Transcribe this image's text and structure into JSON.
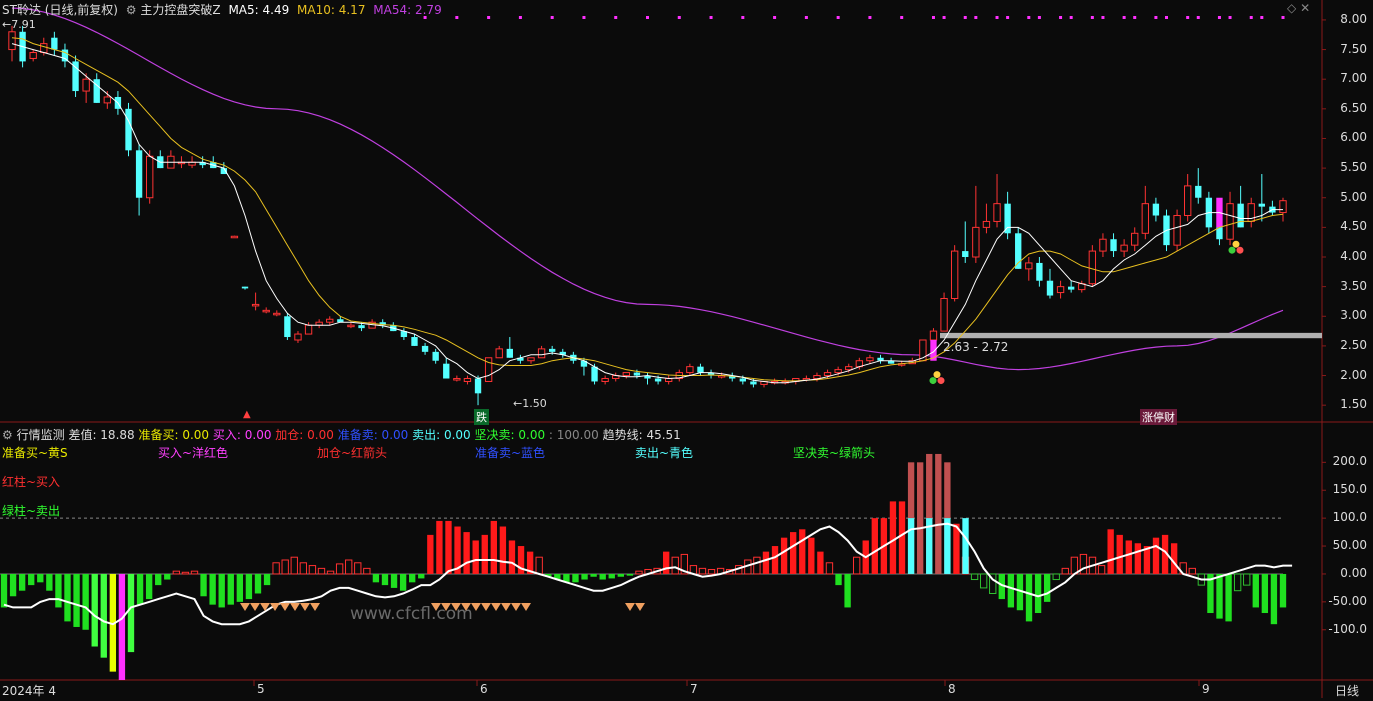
{
  "main_header": {
    "title": "ST聆达 (日线,前复权)",
    "indicator_name": "主力控盘突破Z",
    "ma5": "MA5: 4.49",
    "ma10": "MA10: 4.17",
    "ma54": "MA54: 2.79"
  },
  "sub_header": {
    "name": "行情监测",
    "diff": "差值: 18.88",
    "prep_buy": "准备买: 0.00",
    "buy": "买入: 0.00",
    "add": "加仓: 0.00",
    "prep_sell": "准备卖: 0.00",
    "sell": "卖出: 0.00",
    "firm_sell": "坚决卖: 0.00",
    "scale": ": 100.00",
    "trend": "趋势线: 45.51"
  },
  "legend": {
    "prep_buy": "准备买~黄S",
    "buy": "买入~洋红色",
    "add": "加仓~红箭头",
    "prep_sell": "准备卖~蓝色",
    "sell": "卖出~青色",
    "firm_sell": "坚决卖~绿箭头",
    "red_bar": "红柱~买入",
    "green_bar": "绿柱~卖出"
  },
  "annotations": {
    "high": "7.91",
    "low": "1.50",
    "range": "2.63 - 2.72",
    "fall": "跌",
    "limit_up": "涨停财"
  },
  "price_axis": [
    "8.00",
    "7.50",
    "7.00",
    "6.50",
    "6.00",
    "5.50",
    "5.00",
    "4.50",
    "4.00",
    "3.50",
    "3.00",
    "2.50",
    "2.00",
    "1.50"
  ],
  "osc_axis": [
    "200.0",
    "150.0",
    "100.0",
    "50.00",
    "0.00",
    "-50.00",
    "-100.0"
  ],
  "time_axis": [
    "2024年 4",
    "5",
    "6",
    "7",
    "8",
    "9"
  ],
  "period": "日线",
  "watermark": "www.cfcfl.com",
  "colors": {
    "up": "#ff3333",
    "down": "#54ffff",
    "ma5": "#ffffff",
    "ma10": "#e8c020",
    "ma54": "#c040e0"
  },
  "chart_data": {
    "type": "candlestick",
    "ohlc": [
      [
        7.5,
        7.9,
        7.3,
        7.8
      ],
      [
        7.8,
        7.9,
        7.2,
        7.3
      ],
      [
        7.35,
        7.5,
        7.3,
        7.45
      ],
      [
        7.45,
        7.7,
        7.4,
        7.6
      ],
      [
        7.7,
        7.8,
        7.4,
        7.5
      ],
      [
        7.5,
        7.6,
        7.2,
        7.3
      ],
      [
        7.3,
        7.4,
        6.7,
        6.8
      ],
      [
        6.8,
        7.1,
        6.6,
        7.0
      ],
      [
        7.0,
        7.1,
        6.6,
        6.6
      ],
      [
        6.6,
        6.8,
        6.5,
        6.7
      ],
      [
        6.7,
        6.8,
        6.4,
        6.5
      ],
      [
        6.5,
        6.6,
        5.7,
        5.8
      ],
      [
        5.8,
        5.9,
        4.7,
        5.0
      ],
      [
        5.0,
        5.8,
        4.9,
        5.7
      ],
      [
        5.7,
        5.8,
        5.5,
        5.5
      ],
      [
        5.5,
        5.8,
        5.5,
        5.7
      ],
      [
        5.6,
        5.7,
        5.5,
        5.6
      ],
      [
        5.55,
        5.7,
        5.5,
        5.6
      ],
      [
        5.6,
        5.7,
        5.5,
        5.55
      ],
      [
        5.6,
        5.7,
        5.5,
        5.5
      ],
      [
        5.5,
        5.6,
        5.4,
        5.4
      ],
      [
        4.35,
        4.36,
        4.34,
        4.35
      ],
      [
        3.5,
        3.5,
        3.45,
        3.47
      ],
      [
        3.2,
        3.4,
        3.1,
        3.2
      ],
      [
        3.1,
        3.15,
        3.05,
        3.1
      ],
      [
        3.05,
        3.1,
        3.0,
        3.05
      ],
      [
        3.0,
        3.05,
        2.6,
        2.65
      ],
      [
        2.6,
        2.75,
        2.55,
        2.7
      ],
      [
        2.7,
        2.9,
        2.7,
        2.85
      ],
      [
        2.85,
        2.95,
        2.8,
        2.9
      ],
      [
        2.9,
        3.0,
        2.85,
        2.95
      ],
      [
        2.95,
        3.0,
        2.9,
        2.9
      ],
      [
        2.85,
        2.9,
        2.8,
        2.85
      ],
      [
        2.85,
        2.9,
        2.75,
        2.8
      ],
      [
        2.8,
        2.95,
        2.8,
        2.9
      ],
      [
        2.9,
        2.95,
        2.8,
        2.85
      ],
      [
        2.85,
        2.9,
        2.75,
        2.75
      ],
      [
        2.75,
        2.8,
        2.6,
        2.65
      ],
      [
        2.65,
        2.7,
        2.5,
        2.5
      ],
      [
        2.5,
        2.55,
        2.35,
        2.4
      ],
      [
        2.4,
        2.45,
        2.2,
        2.25
      ],
      [
        2.2,
        2.3,
        1.95,
        1.95
      ],
      [
        1.95,
        2.0,
        1.9,
        1.95
      ],
      [
        1.9,
        2.0,
        1.85,
        1.95
      ],
      [
        1.95,
        2.0,
        1.5,
        1.7
      ],
      [
        1.9,
        2.3,
        1.9,
        2.3
      ],
      [
        2.3,
        2.5,
        2.3,
        2.45
      ],
      [
        2.45,
        2.65,
        2.3,
        2.3
      ],
      [
        2.3,
        2.35,
        2.2,
        2.25
      ],
      [
        2.25,
        2.3,
        2.2,
        2.3
      ],
      [
        2.3,
        2.5,
        2.3,
        2.45
      ],
      [
        2.45,
        2.5,
        2.35,
        2.4
      ],
      [
        2.4,
        2.45,
        2.3,
        2.35
      ],
      [
        2.35,
        2.4,
        2.2,
        2.25
      ],
      [
        2.25,
        2.3,
        2.0,
        2.15
      ],
      [
        2.15,
        2.2,
        1.85,
        1.9
      ],
      [
        1.9,
        2.0,
        1.85,
        1.95
      ],
      [
        1.95,
        2.05,
        1.9,
        2.0
      ],
      [
        2.0,
        2.05,
        1.95,
        2.05
      ],
      [
        2.05,
        2.1,
        1.95,
        2.0
      ],
      [
        2.0,
        2.05,
        1.85,
        1.95
      ],
      [
        1.95,
        2.0,
        1.85,
        1.9
      ],
      [
        1.9,
        2.0,
        1.85,
        1.95
      ],
      [
        1.95,
        2.1,
        1.9,
        2.05
      ],
      [
        2.05,
        2.2,
        2.0,
        2.15
      ],
      [
        2.15,
        2.2,
        2.0,
        2.05
      ],
      [
        2.05,
        2.1,
        1.95,
        2.0
      ],
      [
        2.0,
        2.05,
        1.95,
        2.0
      ],
      [
        2.0,
        2.05,
        1.9,
        1.95
      ],
      [
        1.95,
        2.0,
        1.85,
        1.9
      ],
      [
        1.9,
        1.95,
        1.8,
        1.85
      ],
      [
        1.85,
        1.9,
        1.8,
        1.9
      ],
      [
        1.9,
        1.95,
        1.85,
        1.9
      ],
      [
        1.9,
        1.95,
        1.85,
        1.9
      ],
      [
        1.9,
        1.95,
        1.85,
        1.95
      ],
      [
        1.95,
        2.0,
        1.9,
        1.95
      ],
      [
        1.95,
        2.05,
        1.9,
        2.0
      ],
      [
        2.0,
        2.1,
        1.95,
        2.05
      ],
      [
        2.05,
        2.15,
        2.0,
        2.1
      ],
      [
        2.1,
        2.2,
        2.05,
        2.15
      ],
      [
        2.15,
        2.3,
        2.1,
        2.25
      ],
      [
        2.25,
        2.35,
        2.2,
        2.3
      ],
      [
        2.3,
        2.35,
        2.2,
        2.25
      ],
      [
        2.25,
        2.3,
        2.2,
        2.2
      ],
      [
        2.2,
        2.25,
        2.15,
        2.2
      ],
      [
        2.2,
        2.3,
        2.2,
        2.25
      ],
      [
        2.25,
        2.6,
        2.25,
        2.6
      ],
      [
        2.6,
        2.8,
        2.6,
        2.75
      ],
      [
        2.75,
        3.4,
        2.75,
        3.3
      ],
      [
        3.3,
        4.2,
        3.25,
        4.1
      ],
      [
        4.1,
        4.6,
        3.9,
        4.0
      ],
      [
        4.0,
        5.2,
        3.9,
        4.5
      ],
      [
        4.5,
        4.9,
        4.4,
        4.6
      ],
      [
        4.6,
        5.4,
        4.5,
        4.9
      ],
      [
        4.9,
        5.1,
        4.3,
        4.4
      ],
      [
        4.4,
        4.5,
        3.8,
        3.8
      ],
      [
        3.8,
        4.0,
        3.6,
        3.9
      ],
      [
        3.9,
        4.0,
        3.5,
        3.6
      ],
      [
        3.6,
        3.8,
        3.3,
        3.35
      ],
      [
        3.4,
        3.6,
        3.3,
        3.5
      ],
      [
        3.5,
        3.6,
        3.4,
        3.45
      ],
      [
        3.45,
        3.6,
        3.4,
        3.55
      ],
      [
        3.55,
        4.2,
        3.5,
        4.1
      ],
      [
        4.1,
        4.4,
        4.0,
        4.3
      ],
      [
        4.3,
        4.4,
        4.0,
        4.1
      ],
      [
        4.1,
        4.3,
        4.0,
        4.2
      ],
      [
        4.2,
        4.5,
        4.1,
        4.4
      ],
      [
        4.4,
        5.2,
        4.3,
        4.9
      ],
      [
        4.9,
        5.0,
        4.6,
        4.7
      ],
      [
        4.7,
        4.8,
        4.1,
        4.2
      ],
      [
        4.2,
        4.8,
        4.1,
        4.7
      ],
      [
        4.7,
        5.4,
        4.6,
        5.2
      ],
      [
        5.2,
        5.5,
        4.9,
        5.0
      ],
      [
        5.0,
        5.1,
        4.4,
        4.5
      ],
      [
        4.5,
        4.6,
        4.2,
        4.3
      ],
      [
        4.3,
        5.1,
        4.2,
        4.9
      ],
      [
        4.9,
        5.2,
        4.5,
        4.5
      ],
      [
        4.6,
        5.0,
        4.5,
        4.9
      ],
      [
        4.9,
        5.4,
        4.6,
        4.85
      ],
      [
        4.85,
        4.95,
        4.7,
        4.75
      ],
      [
        4.75,
        5.0,
        4.6,
        4.95
      ]
    ],
    "ma5": [
      7.6,
      7.55,
      7.5,
      7.45,
      7.4,
      7.35,
      7.2,
      7.05,
      6.9,
      6.75,
      6.6,
      6.3,
      5.9,
      5.7,
      5.6,
      5.6,
      5.6,
      5.6,
      5.6,
      5.55,
      5.5,
      5.2,
      4.7,
      4.1,
      3.6,
      3.3,
      3.05,
      2.9,
      2.85,
      2.85,
      2.85,
      2.9,
      2.9,
      2.88,
      2.86,
      2.84,
      2.8,
      2.75,
      2.7,
      2.6,
      2.5,
      2.3,
      2.2,
      2.05,
      1.95,
      2.0,
      2.1,
      2.25,
      2.3,
      2.35,
      2.35,
      2.38,
      2.35,
      2.3,
      2.25,
      2.15,
      2.05,
      2.0,
      1.98,
      1.98,
      2.0,
      1.97,
      1.95,
      1.96,
      2.0,
      2.05,
      2.05,
      2.03,
      2.0,
      1.97,
      1.92,
      1.9,
      1.88,
      1.88,
      1.9,
      1.92,
      1.94,
      1.98,
      2.03,
      2.08,
      2.15,
      2.2,
      2.25,
      2.25,
      2.24,
      2.24,
      2.3,
      2.4,
      2.6,
      2.9,
      3.2,
      3.6,
      3.95,
      4.3,
      4.5,
      4.5,
      4.4,
      4.2,
      4.0,
      3.8,
      3.6,
      3.55,
      3.5,
      3.6,
      3.8,
      3.95,
      4.05,
      4.2,
      4.35,
      4.45,
      4.5,
      4.55,
      4.7,
      4.75,
      4.75,
      4.7,
      4.65,
      4.65,
      4.7,
      4.8,
      4.8
    ],
    "ma10": [
      7.7,
      7.68,
      7.6,
      7.55,
      7.5,
      7.45,
      7.35,
      7.25,
      7.15,
      7.05,
      6.95,
      6.8,
      6.6,
      6.4,
      6.2,
      6.0,
      5.85,
      5.75,
      5.65,
      5.6,
      5.55,
      5.45,
      5.3,
      5.1,
      4.8,
      4.5,
      4.2,
      3.9,
      3.6,
      3.35,
      3.15,
      3.0,
      2.92,
      2.9,
      2.88,
      2.86,
      2.85,
      2.82,
      2.78,
      2.73,
      2.68,
      2.6,
      2.5,
      2.4,
      2.3,
      2.22,
      2.18,
      2.17,
      2.17,
      2.17,
      2.2,
      2.25,
      2.28,
      2.3,
      2.28,
      2.25,
      2.2,
      2.15,
      2.1,
      2.07,
      2.05,
      2.03,
      2.01,
      2.0,
      2.0,
      2.0,
      2.01,
      2.0,
      1.99,
      1.97,
      1.95,
      1.93,
      1.92,
      1.91,
      1.91,
      1.92,
      1.93,
      1.95,
      1.98,
      2.01,
      2.05,
      2.1,
      2.15,
      2.18,
      2.2,
      2.22,
      2.25,
      2.3,
      2.4,
      2.55,
      2.75,
      2.95,
      3.2,
      3.45,
      3.7,
      3.9,
      4.05,
      4.1,
      4.1,
      4.05,
      3.95,
      3.85,
      3.8,
      3.75,
      3.75,
      3.8,
      3.85,
      3.9,
      3.95,
      4.0,
      4.1,
      4.2,
      4.3,
      4.4,
      4.5,
      4.55,
      4.6,
      4.6,
      4.65,
      4.7,
      4.72,
      4.75,
      4.78
    ],
    "ma54_anchor": [
      [
        0,
        8.2
      ],
      [
        25,
        6.5
      ],
      [
        60,
        3.2
      ],
      [
        85,
        2.35
      ],
      [
        95,
        2.1
      ],
      [
        110,
        2.5
      ],
      [
        124,
        3.25
      ]
    ],
    "osc_bars": [
      -60,
      -40,
      -30,
      -20,
      -15,
      -30,
      -60,
      -85,
      -95,
      -100,
      -130,
      -150,
      -175,
      -190,
      -140,
      -55,
      -45,
      -20,
      -10,
      5,
      3,
      5,
      -40,
      -55,
      -60,
      -55,
      -50,
      -45,
      -35,
      -20,
      20,
      25,
      30,
      20,
      15,
      10,
      5,
      18,
      25,
      20,
      10,
      -15,
      -20,
      -25,
      -30,
      -15,
      -8,
      70,
      95,
      95,
      85,
      75,
      60,
      70,
      95,
      85,
      60,
      50,
      40,
      30,
      -5,
      -10,
      -15,
      -15,
      -10,
      -5,
      -10,
      -8,
      -5,
      -3,
      5,
      8,
      10,
      40,
      30,
      35,
      15,
      10,
      8,
      10,
      8,
      15,
      25,
      30,
      40,
      50,
      65,
      75,
      80,
      65,
      40,
      20,
      -20,
      -60,
      30,
      60,
      100,
      100,
      130,
      130,
      200,
      200,
      215,
      215,
      200,
      90,
      30,
      -10,
      -25,
      -35,
      -45,
      -60,
      -65,
      -85,
      -70,
      -50,
      -10,
      10,
      30,
      35,
      30,
      15,
      80,
      70,
      60,
      55,
      50,
      65,
      70,
      55,
      20,
      10,
      -20,
      -70,
      -80,
      -85,
      -30,
      -20,
      -60,
      -70,
      -90,
      -60
    ],
    "osc_trend": [
      -55,
      -60,
      -60,
      -60,
      -50,
      -45,
      -45,
      -50,
      -55,
      -60,
      -75,
      -85,
      -90,
      -80,
      -60,
      -55,
      -50,
      -45,
      -40,
      -35,
      -40,
      -45,
      -75,
      -85,
      -90,
      -90,
      -90,
      -85,
      -75,
      -65,
      -55,
      -50,
      -50,
      -48,
      -45,
      -40,
      -30,
      -25,
      -25,
      -30,
      -35,
      -40,
      -42,
      -40,
      -35,
      -28,
      -20,
      -20,
      -10,
      5,
      10,
      20,
      25,
      25,
      25,
      22,
      20,
      10,
      5,
      0,
      -5,
      -10,
      -15,
      -20,
      -25,
      -30,
      -30,
      -25,
      -20,
      -12,
      -5,
      0,
      5,
      10,
      12,
      5,
      0,
      -5,
      -3,
      0,
      5,
      10,
      15,
      20,
      25,
      30,
      40,
      50,
      60,
      70,
      80,
      85,
      75,
      60,
      40,
      30,
      40,
      50,
      60,
      70,
      80,
      82,
      85,
      88,
      90,
      85,
      65,
      40,
      10,
      -10,
      -20,
      -25,
      -30,
      -35,
      -40,
      -35,
      -25,
      -15,
      0,
      10,
      15,
      20,
      25,
      30,
      35,
      40,
      45,
      50,
      40,
      20,
      0,
      -5,
      -10,
      -10,
      -5,
      0,
      5,
      10,
      15,
      15,
      12,
      15,
      15
    ]
  }
}
